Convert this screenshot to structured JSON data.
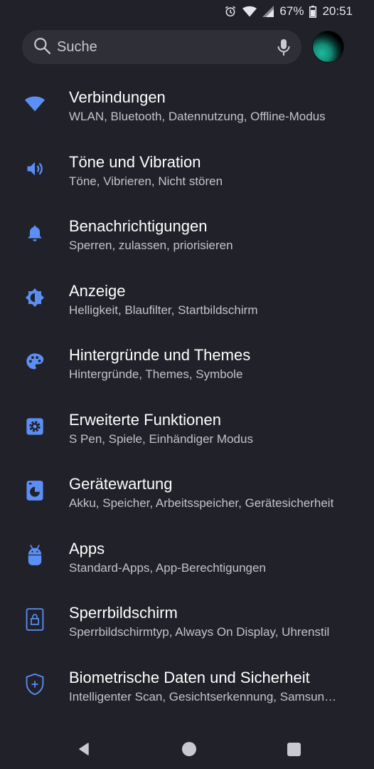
{
  "status_bar": {
    "battery_percent": "67%",
    "time": "20:51",
    "icons": [
      "alarm-icon",
      "wifi-icon",
      "signal-icon",
      "battery-icon"
    ]
  },
  "search": {
    "placeholder": "Suche",
    "icons": [
      "search-icon",
      "mic-icon"
    ]
  },
  "colors": {
    "background": "#212129",
    "accent_icon": "#5b8ff5",
    "title_text": "#ffffff",
    "subtitle_text": "#c3c3c8"
  },
  "items": [
    {
      "title": "Verbindungen",
      "subtitle": "WLAN, Bluetooth, Datennutzung, Offline-Modus",
      "icon": "wifi-icon"
    },
    {
      "title": "Töne und Vibration",
      "subtitle": "Töne, Vibrieren, Nicht stören",
      "icon": "speaker-icon"
    },
    {
      "title": "Benachrichtigungen",
      "subtitle": "Sperren, zulassen, priorisieren",
      "icon": "bell-icon"
    },
    {
      "title": "Anzeige",
      "subtitle": "Helligkeit, Blaufilter, Startbildschirm",
      "icon": "brightness-icon"
    },
    {
      "title": "Hintergründe und Themes",
      "subtitle": "Hintergründe, Themes, Symbole",
      "icon": "palette-icon"
    },
    {
      "title": "Erweiterte Funktionen",
      "subtitle": "S Pen, Spiele, Einhändiger Modus",
      "icon": "gear-icon"
    },
    {
      "title": "Gerätewartung",
      "subtitle": "Akku, Speicher, Arbeitsspeicher, Gerätesicherheit",
      "icon": "device-care-icon"
    },
    {
      "title": "Apps",
      "subtitle": "Standard-Apps, App-Berechtigungen",
      "icon": "android-icon"
    },
    {
      "title": "Sperrbildschirm",
      "subtitle": "Sperrbildschirmtyp, Always On Display, Uhrenstil",
      "icon": "lock-icon"
    },
    {
      "title": "Biometrische Daten und Sicherheit",
      "subtitle": "Intelligenter Scan, Gesichtserkennung, Samsun…",
      "icon": "shield-icon"
    }
  ],
  "nav": [
    "back-icon",
    "home-icon",
    "recents-icon"
  ]
}
